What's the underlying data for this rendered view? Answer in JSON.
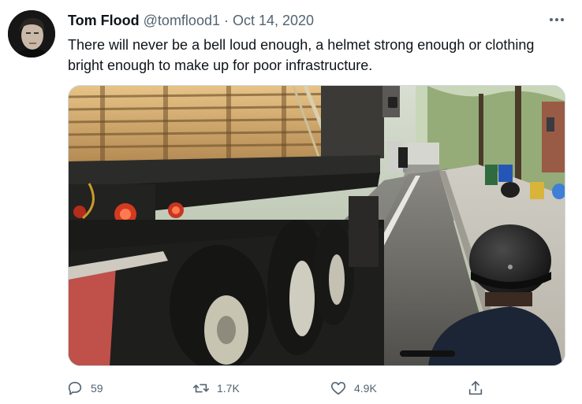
{
  "tweet": {
    "author_name": "Tom Flood",
    "handle": "@tomflood1",
    "separator": "·",
    "date": "Oct 14, 2020",
    "text": "There will never be a bell loud enough, a helmet strong enough or clothing bright enough to make up for poor infrastructure."
  },
  "media": {
    "description_icon": "photo"
  },
  "actions": {
    "replies": "59",
    "retweets": "1.7K",
    "likes": "4.9K"
  },
  "colors": {
    "text": "#0f1419",
    "secondary": "#536471",
    "border": "#cfd9de"
  }
}
